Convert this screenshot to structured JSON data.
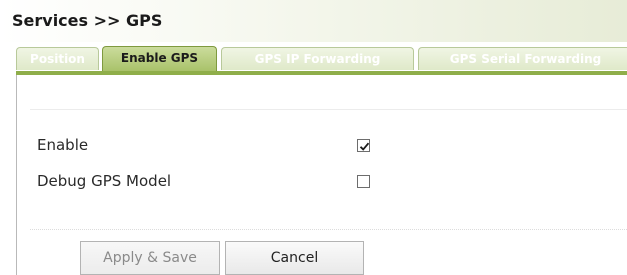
{
  "header": {
    "title": "Services >> GPS"
  },
  "tabs": [
    {
      "label": "Position",
      "active": false
    },
    {
      "label": "Enable GPS",
      "active": true
    },
    {
      "label": "GPS IP Forwarding",
      "active": false
    },
    {
      "label": "GPS Serial Forwarding",
      "active": false
    }
  ],
  "form": {
    "fields": [
      {
        "label": "Enable",
        "checked": true
      },
      {
        "label": "Debug GPS Model",
        "checked": false
      }
    ]
  },
  "buttons": {
    "apply_save": "Apply & Save",
    "cancel": "Cancel"
  },
  "colors": {
    "active_tab": "#a9c26a",
    "inactive_tab": "#dfe9c9",
    "tab_strip": "#8fae4a"
  }
}
